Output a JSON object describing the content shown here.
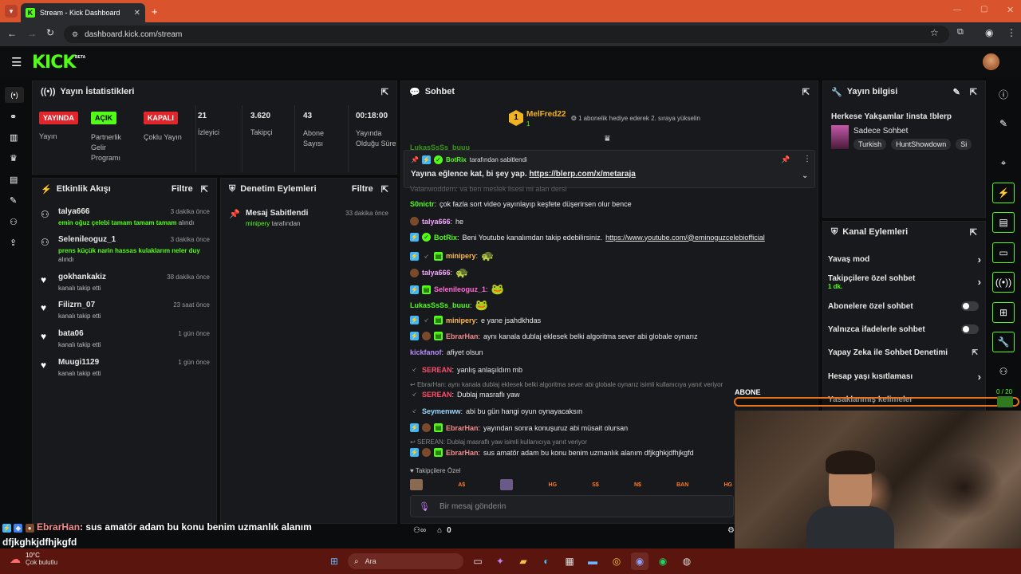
{
  "browser": {
    "tab_title": "Stream - Kick Dashboard",
    "url": "dashboard.kick.com/stream"
  },
  "header": {
    "logo": "KICK",
    "beta": "BETA"
  },
  "stats": {
    "title": "Yayın İstatistikleri",
    "live_badge": "YAYINDA",
    "live_label": "Yayın",
    "partner_badge": "AÇIK",
    "partner_label": "Partnerlik Gelir Programı",
    "multi_badge": "KAPALI",
    "multi_label": "Çoklu Yayın",
    "viewers": "21",
    "viewers_label": "İzleyici",
    "followers": "3.620",
    "followers_label": "Takipçi",
    "subs": "43",
    "subs_label": "Abone Sayısı",
    "duration": "00:18:00",
    "duration_label": "Yayında Olduğu Süre"
  },
  "activity": {
    "title": "Etkinlik Akışı",
    "filter": "Filtre",
    "items": [
      {
        "user": "talya666",
        "time": "3 dakika önce",
        "msg": "emin oğuz çelebi tamam tamam tamam",
        "suffix": "alındı",
        "type": "sub"
      },
      {
        "user": "Selenileoguz_1",
        "time": "3 dakika önce",
        "msg": "prens küçük narin hassas kulaklarım neler duy",
        "suffix": "alındı",
        "type": "sub"
      },
      {
        "user": "gokhankakiz",
        "time": "38 dakika önce",
        "msg": "kanalı takip etti",
        "suffix": "",
        "type": "follow"
      },
      {
        "user": "Filizrn_07",
        "time": "23 saat önce",
        "msg": "kanalı takip etti",
        "suffix": "",
        "type": "follow"
      },
      {
        "user": "bata06",
        "time": "1 gün önce",
        "msg": "kanalı takip etti",
        "suffix": "",
        "type": "follow"
      },
      {
        "user": "Muugi1129",
        "time": "1 gün önce",
        "msg": "kanalı takip etti",
        "suffix": "",
        "type": "follow"
      }
    ]
  },
  "moderation": {
    "title": "Denetim Eylemleri",
    "filter": "Filtre",
    "item_title": "Mesaj Sabitlendi",
    "item_time": "33 dakika önce",
    "item_user": "minipery",
    "item_suffix": "tarafından"
  },
  "chat": {
    "title": "Sohbet",
    "top_user": "MelFred22",
    "top_count": "1",
    "top_rank": "1",
    "top_msg": "1 abonelik hediye ederek 2. sıraya yükselin",
    "cut_user": "LukasSsSs_buuu",
    "pinned_by": "BotRix",
    "pinned_by_suffix": "tarafından sabitlendi",
    "pinned_text": "Yayına eğlence kat, bi şey yap.",
    "pinned_link": "https://blerp.com/x/metaraja",
    "cut_line": "Vatanwoddern: ya ben meslek lisesi mi alan dersi",
    "messages": [
      {
        "user": "S0nictr",
        "color": "#53fc18",
        "text": "çok fazla sort video yayınlayıp keşfete düşerirsen olur bence"
      },
      {
        "user": "talya666",
        "color": "#f2a6ff",
        "text": "he"
      },
      {
        "user": "BotRix",
        "color": "#53fc18",
        "text": "Beni Youtube kanalımdan takip edebilirsiniz.",
        "link": "https://www.youtube.com/@eminoguzcelebiofficial"
      },
      {
        "user": "minipery",
        "color": "#ffb84d",
        "text": ""
      },
      {
        "user": "talya666",
        "color": "#f2a6ff",
        "text": ""
      },
      {
        "user": "Selenileoguz_1",
        "color": "#ff6ad5",
        "text": ""
      },
      {
        "user": "LukasSsSs_buuu",
        "color": "#53fc18",
        "text": ""
      },
      {
        "user": "minipery",
        "color": "#ffb84d",
        "text": "e yane jsahdkhdas"
      },
      {
        "user": "EbrarHan",
        "color": "#f28b8b",
        "text": "aynı kanala dublaj eklesek belki algoritma sever abi globale oynarız"
      },
      {
        "user": "kickfanof",
        "color": "#b58cff",
        "text": "afiyet olsun"
      },
      {
        "user": "SEREAN",
        "color": "#ff4d6d",
        "text": "yanlış anlaşıldım mb"
      },
      {
        "user": "SEREAN",
        "color": "#ff4d6d",
        "text": "Dublaj masraflı yaw"
      },
      {
        "user": "Seymenww",
        "color": "#9ad7ff",
        "text": "abi bu gün hangi oyun oynayacaksın"
      },
      {
        "user": "EbrarHan",
        "color": "#f28b8b",
        "text": "yayından sonra konuşuruz abi müsait olursan"
      },
      {
        "user": "EbrarHan",
        "color": "#f28b8b",
        "text": "sus amatör adam bu konu benim uzmanlık alanım dfjkghkjdfhjkgfd"
      }
    ],
    "reply1": "EbrarHan: aynı kanala dublaj eklesek belki algoritma sever abi globale oynarız isimli kullanıcıya yanıt veriyor",
    "reply2": "SEREAN: Dublaj masraflı yaw isimli kullanıcıya yanıt veriyor",
    "follower_only": "Takipçilere Özel",
    "emotes": [
      "A$",
      "HG",
      "S$",
      "N$",
      "BAN",
      "HG"
    ],
    "input_placeholder": "Bir mesaj gönderin",
    "points": "0"
  },
  "info": {
    "title": "Yayın bilgisi",
    "stream_title": "Herkese Yakşamlar !insta !blerp",
    "category": "Sadece Sohbet",
    "tags": [
      "Turkish",
      "HuntShowdown",
      "Si"
    ]
  },
  "channel_actions": {
    "title": "Kanal Eylemleri",
    "slow": "Yavaş mod",
    "followers_only": "Takipçilere özel sohbet",
    "followers_only_sub": "1 dk.",
    "subs_only": "Abonelere özel sohbet",
    "emotes_only": "Yalnızca ifadelerle sohbet",
    "ai_mod": "Yapay Zeka ile Sohbet Denetimi",
    "age": "Hesap yaşı kısıtlaması",
    "banned": "Yasaklanmış kelimeler"
  },
  "overlay": {
    "abone": "ABONE",
    "progress": "0 / 20",
    "bottom_user": "EbrarHan",
    "bottom_msg": "sus amatör adam bu konu benim uzmanlık alanım dfjkghkjdfhjkgfd"
  },
  "taskbar": {
    "temp": "10°C",
    "weather": "Çok bulutlu",
    "search": "Ara"
  }
}
